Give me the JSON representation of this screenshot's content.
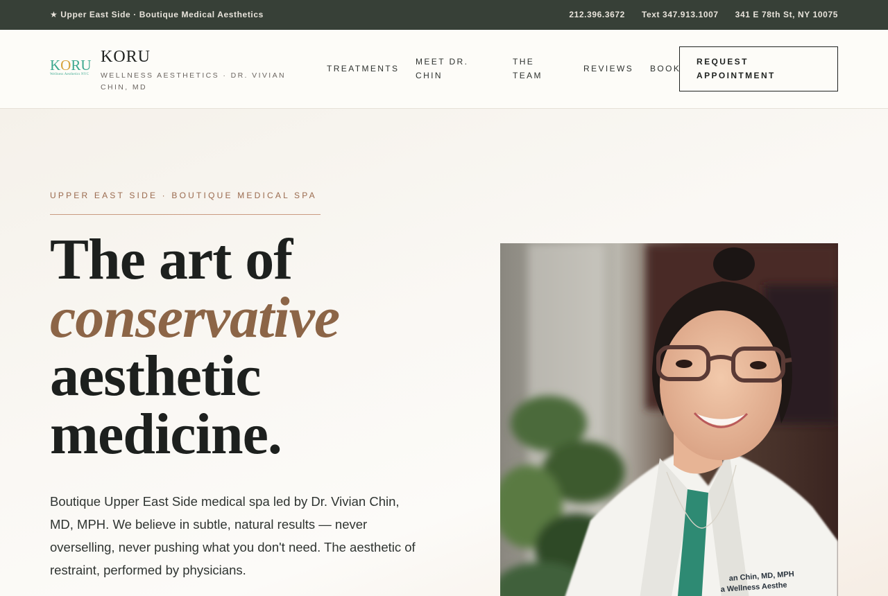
{
  "topbar": {
    "tagline": "★ Upper East Side · Boutique Medical Aesthetics",
    "phone": "212.396.3672",
    "text": "Text 347.913.1007",
    "address": "341 E 78th St, NY 10075"
  },
  "brand": {
    "logo_word": "KORU",
    "logo_sub": "Wellness Aesthetics NYC",
    "name": "KORU",
    "tagline": "WELLNESS AESTHETICS · DR. VIVIAN CHIN, MD"
  },
  "nav": {
    "items": [
      "TREATMENTS",
      "MEET DR. CHIN",
      "THE TEAM",
      "REVIEWS",
      "BOOK"
    ],
    "cta": "REQUEST APPOINTMENT"
  },
  "hero": {
    "eyebrow": "UPPER EAST SIDE · BOUTIQUE MEDICAL SPA",
    "headline": [
      "The art of",
      "conservative",
      "aesthetic",
      "medicine."
    ],
    "lede": "Boutique Upper East Side medical spa led by Dr. Vivian Chin, MD, MPH. We believe in subtle, natural results — never overselling, never pushing what you don't need. The aesthetic of restraint, performed by physicians.",
    "portrait_embroidery": "Vivian Chin, MD, MPH Koru Wellness Aesthetics"
  },
  "colors": {
    "topbar_bg": "#374037",
    "accent": "#8c6547",
    "eyebrow": "#9a6a4e",
    "logo_green": "#3ba88f",
    "logo_gold": "#d7a33c"
  }
}
